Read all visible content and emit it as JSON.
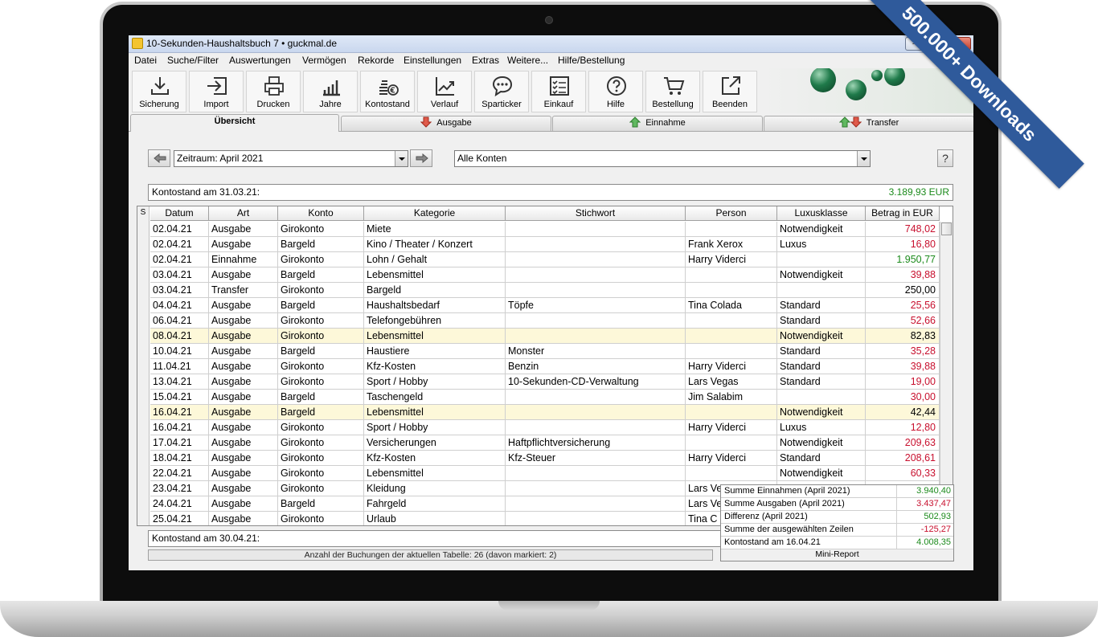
{
  "window": {
    "title": "10-Sekunden-Haushaltsbuch 7  •  guckmal.de",
    "minimize": "–",
    "maximize": "□",
    "close": "✕"
  },
  "banner": "500.000+ Downloads",
  "menu": [
    "Datei",
    "Suche/Filter",
    "Auswertungen",
    "Vermögen",
    "Rekorde",
    "Einstellungen",
    "Extras",
    "Weitere...",
    "Hilfe/Bestellung"
  ],
  "toolbar": [
    {
      "label": "Sicherung",
      "icon": "download-tray-icon"
    },
    {
      "label": "Import",
      "icon": "import-arrow-icon"
    },
    {
      "label": "Drucken",
      "icon": "printer-icon"
    },
    {
      "label": "Jahre",
      "icon": "bar-chart-icon"
    },
    {
      "label": "Kontostand",
      "icon": "coins-euro-icon"
    },
    {
      "label": "Verlauf",
      "icon": "line-chart-icon"
    },
    {
      "label": "Sparticker",
      "icon": "speech-bubble-icon"
    },
    {
      "label": "Einkauf",
      "icon": "checklist-icon"
    },
    {
      "label": "Hilfe",
      "icon": "help-circle-icon"
    },
    {
      "label": "Bestellung",
      "icon": "shopping-cart-icon"
    },
    {
      "label": "Beenden",
      "icon": "exit-arrow-icon"
    }
  ],
  "tabs": {
    "overview": "Übersicht",
    "expense": "Ausgabe",
    "income": "Einnahme",
    "transfer": "Transfer"
  },
  "filters": {
    "period": "Zeitraum: April 2021",
    "accounts": "Alle Konten",
    "help": "?"
  },
  "balance_start": {
    "label": "Kontostand am 31.03.21:",
    "value": "3.189,93 EUR"
  },
  "balance_end": {
    "label": "Kontostand am 30.04.21:"
  },
  "table": {
    "selector_header": "S",
    "columns": [
      "Datum",
      "Art",
      "Konto",
      "Kategorie",
      "Stichwort",
      "Person",
      "Luxusklasse",
      "Betrag in EUR"
    ],
    "rows": [
      [
        "02.04.21",
        "Ausgabe",
        "Girokonto",
        "Miete",
        "",
        "",
        "Notwendigkeit",
        "748,02"
      ],
      [
        "02.04.21",
        "Ausgabe",
        "Bargeld",
        "Kino / Theater / Konzert",
        "",
        "Frank Xerox",
        "Luxus",
        "16,80"
      ],
      [
        "02.04.21",
        "Einnahme",
        "Girokonto",
        "Lohn / Gehalt",
        "",
        "Harry Viderci",
        "",
        "1.950,77"
      ],
      [
        "03.04.21",
        "Ausgabe",
        "Bargeld",
        "Lebensmittel",
        "",
        "",
        "Notwendigkeit",
        "39,88"
      ],
      [
        "03.04.21",
        "Transfer",
        "Girokonto",
        "Bargeld",
        "",
        "",
        "",
        "250,00"
      ],
      [
        "04.04.21",
        "Ausgabe",
        "Bargeld",
        "Haushaltsbedarf",
        "Töpfe",
        "Tina Colada",
        "Standard",
        "25,56"
      ],
      [
        "06.04.21",
        "Ausgabe",
        "Girokonto",
        "Telefongebühren",
        "",
        "",
        "Standard",
        "52,66"
      ],
      [
        "08.04.21",
        "Ausgabe",
        "Girokonto",
        "Lebensmittel",
        "",
        "",
        "Notwendigkeit",
        "82,83"
      ],
      [
        "10.04.21",
        "Ausgabe",
        "Bargeld",
        "Haustiere",
        "Monster",
        "",
        "Standard",
        "35,28"
      ],
      [
        "11.04.21",
        "Ausgabe",
        "Girokonto",
        "Kfz-Kosten",
        "Benzin",
        "Harry Viderci",
        "Standard",
        "39,88"
      ],
      [
        "13.04.21",
        "Ausgabe",
        "Girokonto",
        "Sport / Hobby",
        "10-Sekunden-CD-Verwaltung",
        "Lars Vegas",
        "Standard",
        "19,00"
      ],
      [
        "15.04.21",
        "Ausgabe",
        "Bargeld",
        "Taschengeld",
        "",
        "Jim Salabim",
        "",
        "30,00"
      ],
      [
        "16.04.21",
        "Ausgabe",
        "Bargeld",
        "Lebensmittel",
        "",
        "",
        "Notwendigkeit",
        "42,44"
      ],
      [
        "16.04.21",
        "Ausgabe",
        "Girokonto",
        "Sport / Hobby",
        "",
        "Harry Viderci",
        "Luxus",
        "12,80"
      ],
      [
        "17.04.21",
        "Ausgabe",
        "Girokonto",
        "Versicherungen",
        "Haftpflichtversicherung",
        "",
        "Notwendigkeit",
        "209,63"
      ],
      [
        "18.04.21",
        "Ausgabe",
        "Girokonto",
        "Kfz-Kosten",
        "Kfz-Steuer",
        "Harry Viderci",
        "Standard",
        "208,61"
      ],
      [
        "22.04.21",
        "Ausgabe",
        "Girokonto",
        "Lebensmittel",
        "",
        "",
        "Notwendigkeit",
        "60,33"
      ],
      [
        "23.04.21",
        "Ausgabe",
        "Girokonto",
        "Kleidung",
        "",
        "Lars Ve",
        "",
        ""
      ],
      [
        "24.04.21",
        "Ausgabe",
        "Bargeld",
        "Fahrgeld",
        "",
        "Lars Ve",
        "",
        ""
      ],
      [
        "25.04.21",
        "Ausgabe",
        "Girokonto",
        "Urlaub",
        "",
        "Tina C",
        "",
        ""
      ]
    ],
    "marked_rows": [
      7,
      12
    ],
    "amount_color": [
      "neg",
      "neg",
      "pos",
      "neg",
      "",
      "neg",
      "neg",
      "",
      "neg",
      "neg",
      "neg",
      "neg",
      "",
      "neg",
      "neg",
      "neg",
      "neg",
      "",
      "",
      ""
    ]
  },
  "status": "Anzahl der Buchungen der aktuellen Tabelle: 26 (davon markiert:  2)",
  "mini_report": {
    "rows": [
      {
        "label": "Summe Einnahmen (April 2021)",
        "value": "3.940,40",
        "color": "pos"
      },
      {
        "label": "Summe Ausgaben (April 2021)",
        "value": "3.437,47",
        "color": "neg"
      },
      {
        "label": "Differenz (April 2021)",
        "value": "502,93",
        "color": "pos"
      },
      {
        "label": "Summe der ausgewählten Zeilen",
        "value": "-125,27",
        "color": "neg"
      },
      {
        "label": "Kontostand am 16.04.21",
        "value": "4.008,35",
        "color": "pos"
      }
    ],
    "caption": "Mini-Report"
  },
  "colors": {
    "negative": "#c8102e",
    "positive": "#1b8a1b",
    "marked_row": "#fdf8d9",
    "banner": "#2f5a9b"
  }
}
